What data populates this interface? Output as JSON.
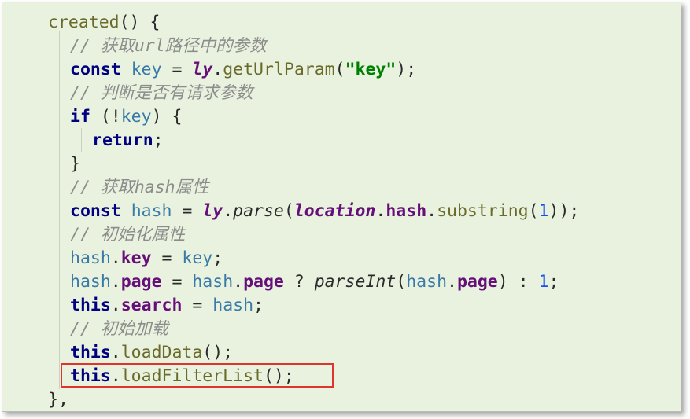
{
  "editor": {
    "lines": [
      [
        {
          "t": "created",
          "c": "fn"
        },
        {
          "t": "() {",
          "c": "plain"
        }
      ],
      [
        {
          "t": "// 获取url路径中的参数",
          "c": "cmt"
        }
      ],
      [
        {
          "t": "const",
          "c": "kw"
        },
        {
          "t": " ",
          "c": "plain"
        },
        {
          "t": "key",
          "c": "var"
        },
        {
          "t": " = ",
          "c": "plain"
        },
        {
          "t": "ly",
          "c": "prop ital"
        },
        {
          "t": ".",
          "c": "plain"
        },
        {
          "t": "getUrlParam",
          "c": "fn"
        },
        {
          "t": "(",
          "c": "plain"
        },
        {
          "t": "\"key\"",
          "c": "str"
        },
        {
          "t": ");",
          "c": "plain"
        }
      ],
      [
        {
          "t": "// 判断是否有请求参数",
          "c": "cmt"
        }
      ],
      [
        {
          "t": "if",
          "c": "kw"
        },
        {
          "t": " (!",
          "c": "plain"
        },
        {
          "t": "key",
          "c": "var"
        },
        {
          "t": ") {",
          "c": "plain"
        }
      ],
      [
        {
          "t": "return",
          "c": "kw"
        },
        {
          "t": ";",
          "c": "plain"
        }
      ],
      [
        {
          "t": "}",
          "c": "plain"
        }
      ],
      [
        {
          "t": "// 获取hash属性",
          "c": "cmt"
        }
      ],
      [
        {
          "t": "const",
          "c": "kw"
        },
        {
          "t": " ",
          "c": "plain"
        },
        {
          "t": "hash",
          "c": "var"
        },
        {
          "t": " = ",
          "c": "plain"
        },
        {
          "t": "ly",
          "c": "prop ital"
        },
        {
          "t": ".",
          "c": "plain"
        },
        {
          "t": "parse",
          "c": "plain ital"
        },
        {
          "t": "(",
          "c": "plain"
        },
        {
          "t": "location",
          "c": "prop ital"
        },
        {
          "t": ".",
          "c": "plain"
        },
        {
          "t": "hash",
          "c": "prop"
        },
        {
          "t": ".",
          "c": "plain"
        },
        {
          "t": "substring",
          "c": "fn"
        },
        {
          "t": "(",
          "c": "plain"
        },
        {
          "t": "1",
          "c": "num"
        },
        {
          "t": "));",
          "c": "plain"
        }
      ],
      [
        {
          "t": "// 初始化属性",
          "c": "cmt"
        }
      ],
      [
        {
          "t": "hash",
          "c": "var"
        },
        {
          "t": ".",
          "c": "plain"
        },
        {
          "t": "key",
          "c": "prop"
        },
        {
          "t": " = ",
          "c": "plain"
        },
        {
          "t": "key",
          "c": "var"
        },
        {
          "t": ";",
          "c": "plain"
        }
      ],
      [
        {
          "t": "hash",
          "c": "var"
        },
        {
          "t": ".",
          "c": "plain"
        },
        {
          "t": "page",
          "c": "prop"
        },
        {
          "t": " = ",
          "c": "plain"
        },
        {
          "t": "hash",
          "c": "var"
        },
        {
          "t": ".",
          "c": "plain"
        },
        {
          "t": "page",
          "c": "prop"
        },
        {
          "t": " ? ",
          "c": "plain"
        },
        {
          "t": "parseInt",
          "c": "plain ital"
        },
        {
          "t": "(",
          "c": "plain"
        },
        {
          "t": "hash",
          "c": "var"
        },
        {
          "t": ".",
          "c": "plain"
        },
        {
          "t": "page",
          "c": "prop"
        },
        {
          "t": ") : ",
          "c": "plain"
        },
        {
          "t": "1",
          "c": "num"
        },
        {
          "t": ";",
          "c": "plain"
        }
      ],
      [
        {
          "t": "this",
          "c": "kw"
        },
        {
          "t": ".",
          "c": "plain"
        },
        {
          "t": "search",
          "c": "prop"
        },
        {
          "t": " = ",
          "c": "plain"
        },
        {
          "t": "hash",
          "c": "var"
        },
        {
          "t": ";",
          "c": "plain"
        }
      ],
      [
        {
          "t": "// 初始加载",
          "c": "cmt"
        }
      ],
      [
        {
          "t": "this",
          "c": "kw"
        },
        {
          "t": ".",
          "c": "plain"
        },
        {
          "t": "loadData",
          "c": "fn"
        },
        {
          "t": "();",
          "c": "plain"
        }
      ],
      [
        {
          "t": "this",
          "c": "kw"
        },
        {
          "t": ".",
          "c": "plain"
        },
        {
          "t": "loadFilterList",
          "c": "fn"
        },
        {
          "t": "();",
          "c": "plain"
        }
      ],
      [
        {
          "t": "},",
          "c": "plain"
        }
      ]
    ]
  },
  "colors": {
    "background": "#e8f2de",
    "highlight_border": "#e0352f"
  }
}
